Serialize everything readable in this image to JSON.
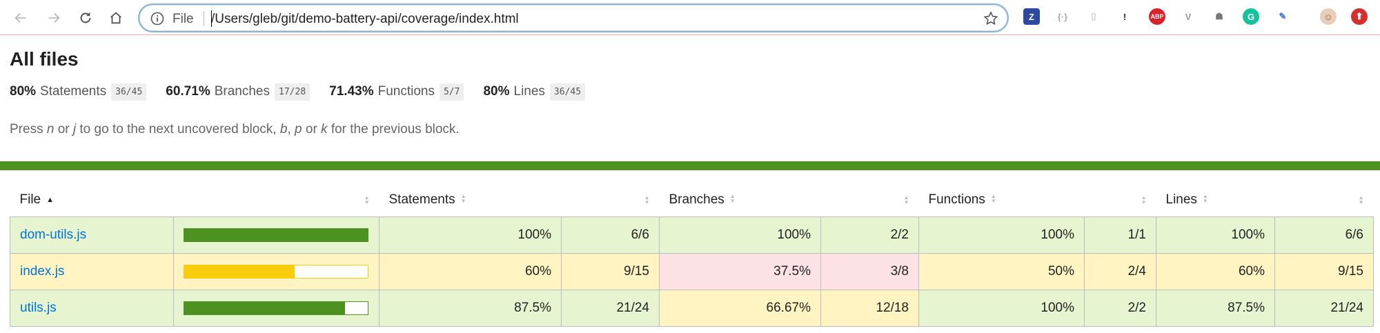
{
  "browser": {
    "scheme": "File",
    "url": "/Users/gleb/git/demo-battery-api/coverage/index.html",
    "extensions": [
      {
        "name": "z-extension-icon",
        "glyph": "Z",
        "color": "#ffffff",
        "bg": "#2e4a9e"
      },
      {
        "name": "code-extension-icon",
        "glyph": "{·}",
        "color": "#aaaaaa",
        "bg": "transparent"
      },
      {
        "name": "page-extension-icon",
        "glyph": "▯",
        "color": "#cccccc",
        "bg": "transparent"
      },
      {
        "name": "1password-icon",
        "glyph": "!",
        "color": "#222222",
        "bg": "transparent"
      },
      {
        "name": "adblock-plus-icon",
        "glyph": "ABP",
        "color": "#ffffff",
        "bg": "#d8232a"
      },
      {
        "name": "vue-devtools-icon",
        "glyph": "V",
        "color": "#999999",
        "bg": "transparent"
      },
      {
        "name": "robot-extension-icon",
        "glyph": "☗",
        "color": "#777777",
        "bg": "transparent"
      },
      {
        "name": "grammarly-icon",
        "glyph": "G",
        "color": "#ffffff",
        "bg": "#15c39a"
      },
      {
        "name": "feather-extension-icon",
        "glyph": "✎",
        "color": "#3a7bd5",
        "bg": "transparent"
      },
      {
        "name": "profile-avatar-icon",
        "glyph": "☺",
        "color": "#8a5a44",
        "bg": "#e8cdb8"
      },
      {
        "name": "update-icon",
        "glyph": "⬆",
        "color": "#ffffff",
        "bg": "#d32f2f"
      }
    ]
  },
  "page": {
    "title": "All files",
    "summary": [
      {
        "pct": "80%",
        "label": "Statements",
        "frac": "36/45"
      },
      {
        "pct": "60.71%",
        "label": "Branches",
        "frac": "17/28"
      },
      {
        "pct": "71.43%",
        "label": "Functions",
        "frac": "5/7"
      },
      {
        "pct": "80%",
        "label": "Lines",
        "frac": "36/45"
      }
    ],
    "hint": {
      "p1": "Press ",
      "k1": "n",
      "p2": " or ",
      "k2": "j",
      "p3": " to go to the next uncovered block, ",
      "k3": "b",
      "p4": ", ",
      "k4": "p",
      "p5": " or ",
      "k5": "k",
      "p6": " for the previous block."
    },
    "status_color": "#4d9221"
  },
  "table": {
    "headers": {
      "file": "File",
      "statements": "Statements",
      "branches": "Branches",
      "functions": "Functions",
      "lines": "Lines"
    },
    "rows": [
      {
        "file": "dom-utils.js",
        "level": "high",
        "bar_fraction": 1.0,
        "statements_pct": "100%",
        "statements_frac": "6/6",
        "statements_level": "high",
        "branches_pct": "100%",
        "branches_frac": "2/2",
        "branches_level": "high",
        "functions_pct": "100%",
        "functions_frac": "1/1",
        "functions_level": "high",
        "lines_pct": "100%",
        "lines_frac": "6/6",
        "lines_level": "high"
      },
      {
        "file": "index.js",
        "level": "medium",
        "bar_fraction": 0.6,
        "statements_pct": "60%",
        "statements_frac": "9/15",
        "statements_level": "medium",
        "branches_pct": "37.5%",
        "branches_frac": "3/8",
        "branches_level": "low",
        "functions_pct": "50%",
        "functions_frac": "2/4",
        "functions_level": "medium",
        "lines_pct": "60%",
        "lines_frac": "9/15",
        "lines_level": "medium"
      },
      {
        "file": "utils.js",
        "level": "high",
        "bar_fraction": 0.875,
        "statements_pct": "87.5%",
        "statements_frac": "21/24",
        "statements_level": "high",
        "branches_pct": "66.67%",
        "branches_frac": "12/18",
        "branches_level": "medium",
        "functions_pct": "100%",
        "functions_frac": "2/2",
        "functions_level": "high",
        "lines_pct": "87.5%",
        "lines_frac": "21/24",
        "lines_level": "high"
      }
    ]
  }
}
